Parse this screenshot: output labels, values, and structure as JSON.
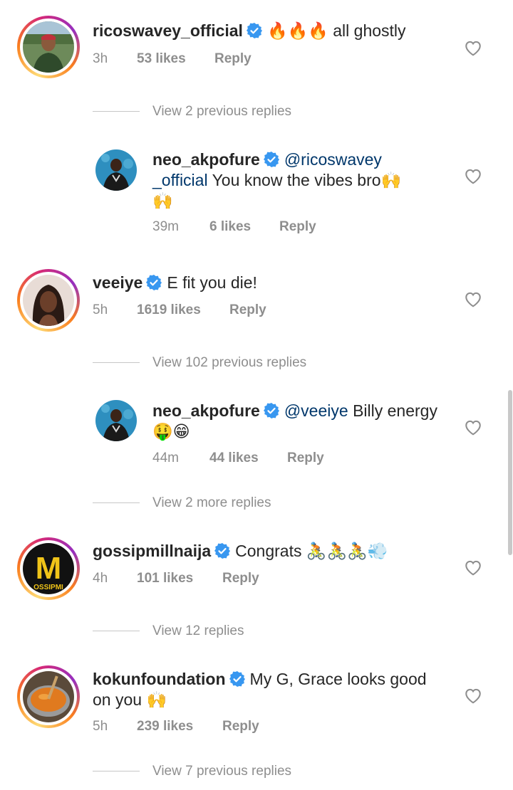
{
  "comments": [
    {
      "username": "ricoswavey_official",
      "mention": "",
      "text": "🔥🔥🔥 all ghostly",
      "time": "3h",
      "likes": "53 likes",
      "reply": "Reply",
      "avatar": "man-outdoors-avatar"
    },
    {
      "username": "neo_akpofure",
      "mention": "@ricoswavey _official",
      "text": "You know the vibes bro🙌 🙌",
      "time": "39m",
      "likes": "6 likes",
      "reply": "Reply",
      "avatar": "man-water-avatar"
    },
    {
      "username": "veeiye",
      "mention": "",
      "text": "E fit you die!",
      "time": "5h",
      "likes": "1619 likes",
      "reply": "Reply",
      "avatar": "woman-avatar"
    },
    {
      "username": "neo_akpofure",
      "mention": "@veeiye",
      "text": "Billy energy 🤑😁",
      "time": "44m",
      "likes": "44 likes",
      "reply": "Reply",
      "avatar": "man-water-avatar"
    },
    {
      "username": "gossipmillnaija",
      "mention": "",
      "text": "Congrats 🚴🚴🚴💨",
      "time": "4h",
      "likes": "101 likes",
      "reply": "Reply",
      "avatar": "gossipmill-logo",
      "logo_letter": "M",
      "logo_text": "OSSIPMI"
    },
    {
      "username": "kokunfoundation",
      "mention": "",
      "text": "My G, Grace looks good on you 🙌",
      "time": "5h",
      "likes": "239 likes",
      "reply": "Reply",
      "avatar": "food-pot-avatar"
    }
  ],
  "view_replies": [
    "View 2 previous replies",
    "View 102 previous replies",
    "View 2 more replies",
    "View 12 replies",
    "View 7 previous replies"
  ],
  "colors": {
    "verified": "#3897f0",
    "mention": "#00376b",
    "meta": "#8e8e8e"
  },
  "icons": {
    "like": "heart-icon",
    "verified": "verified-badge-icon"
  }
}
